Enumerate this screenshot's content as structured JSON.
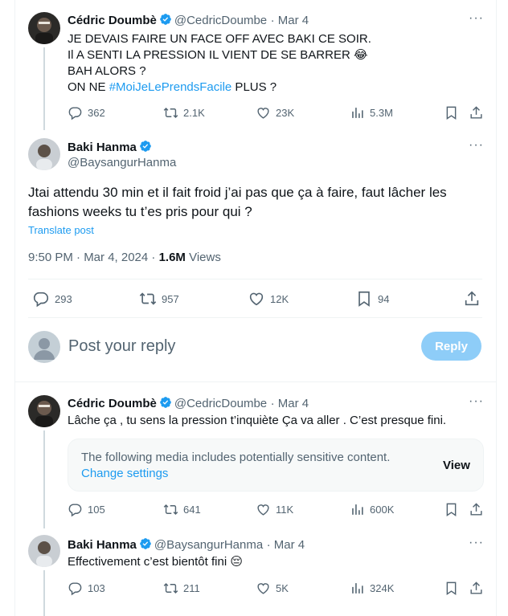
{
  "tweet1": {
    "name": "Cédric Doumbè",
    "handle": "@CedricDoumbe",
    "date": "· Mar 4",
    "lines": [
      "JE DEVAIS FAIRE UN FACE OFF AVEC BAKI CE SOIR.",
      "Il A SENTI LA PRESSION IL VIENT DE SE BARRER",
      "BAH ALORS ?"
    ],
    "line4_prefix": "ON NE ",
    "hashtag": "#MoiJeLePrendsFacile",
    "line4_suffix": " PLUS ?",
    "emoji": "😂",
    "replies": "362",
    "reposts": "2.1K",
    "likes": "23K",
    "views": "5.3M"
  },
  "main": {
    "name": "Baki Hanma",
    "handle": "@BaysangurHanma",
    "text": "Jtai attendu 30 min et il fait froid j’ai pas que ça à faire, faut lâcher les fashions weeks tu t’es pris pour qui ?",
    "translate": "Translate post",
    "timestamp": "9:50 PM · Mar 4, 2024 · ",
    "views_count": "1.6M",
    "views_label": " Views",
    "replies": "293",
    "reposts": "957",
    "likes": "12K",
    "bookmarks": "94"
  },
  "reply_box": {
    "placeholder": "Post your reply",
    "button": "Reply"
  },
  "reply1": {
    "name": "Cédric Doumbè",
    "handle": "@CedricDoumbe",
    "date": "· Mar 4",
    "text": "Lâche ça , tu sens la pression t’inquiète Ça va aller . C’est presque fini.",
    "media_notice": "The following media includes potentially sensitive content.",
    "media_link": "Change settings",
    "media_view": "View",
    "replies": "105",
    "reposts": "641",
    "likes": "11K",
    "views": "600K"
  },
  "reply2": {
    "name": "Baki Hanma",
    "handle": "@BaysangurHanma",
    "date": "· Mar 4",
    "text": "Effectivement c’est bientôt fini",
    "emoji": "😔",
    "replies": "103",
    "reposts": "211",
    "likes": "5K",
    "views": "324K"
  },
  "colors": {
    "accent": "#1d9bf0",
    "text": "#0f1419",
    "muted": "#536471",
    "reply_button": "#8ecdf8"
  }
}
